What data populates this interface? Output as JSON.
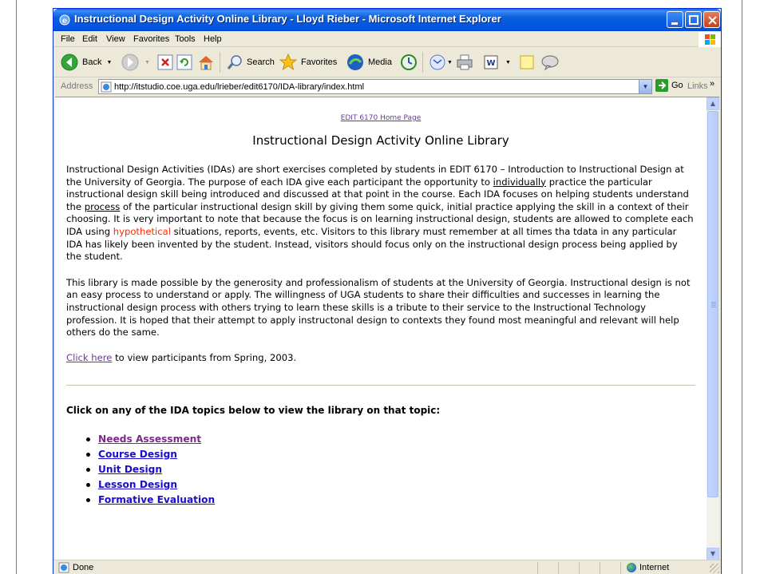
{
  "window": {
    "title": "Instructional Design Activity Online Library - Lloyd Rieber - Microsoft Internet Explorer"
  },
  "menu": {
    "items": [
      "File",
      "Edit",
      "View",
      "Favorites",
      "Tools",
      "Help"
    ]
  },
  "toolbar": {
    "back_label": "Back",
    "search_label": "Search",
    "favorites_label": "Favorites",
    "media_label": "Media"
  },
  "address": {
    "label": "Address",
    "url": "http://itstudio.coe.uga.edu/lrieber/edit6170/IDA-library/index.html",
    "go_label": "Go",
    "links_label": "Links",
    "links_chevron": "»"
  },
  "page": {
    "home_link": "EDIT 6170 Home Page",
    "title": "Instructional Design Activity Online Library",
    "p1_a": "Instructional Design Activities (IDAs) are short exercises completed by students in EDIT 6170 – Introduction to Instructional Design at the University of Georgia. The purpose of each IDA give each participant the opportunity to ",
    "p1_u1": "individually",
    "p1_b": " practice the particular instructional design skill being introduced and discussed at that point in the course. Each IDA focuses on helping students understand the ",
    "p1_u2": "process",
    "p1_c": " of the particular instructional design skill by giving them some quick, initial practice applying the skill in a context of their choosing. It is very important to note that because the focus is on learning instructional design, students are allowed to complete each IDA using ",
    "p1_red": "hypothetical",
    "p1_d": " situations, reports, events, etc. Visitors to this library must remember at all times tha tdata in any particular IDA has likely been invented by the student. Instead, visitors should focus only on the instructional design process being applied by the student.",
    "p2": "This library is made possible by the generosity and professionalism of students at the University of Georgia. Instructional design is not an easy process to understand or apply. The willingness of UGA students to share their difficulties and successes in learning the instructional design process with others trying to learn these skills is a tribute to their service to the Instructional Technology profession. It is hoped that their attempt to apply instructonal design to contexts they found most meaningful and relevant will help others do the same.",
    "click_here": "Click here",
    "spring_text": " to view participants from Spring, 2003.",
    "topics_heading": "Click on any of the IDA topics below to view the library on that topic:",
    "topics": [
      "Needs Assessment",
      "Course Design",
      "Unit Design",
      "Lesson Design",
      "Formative Evaluation"
    ]
  },
  "status": {
    "text": "Done",
    "zone": "Internet"
  },
  "colors": {
    "visited_link": "#6a3a9a",
    "unvisited_link": "#1a0dd0",
    "highlight_red": "#ff2a00",
    "titlebar_blue": "#0054e3"
  }
}
